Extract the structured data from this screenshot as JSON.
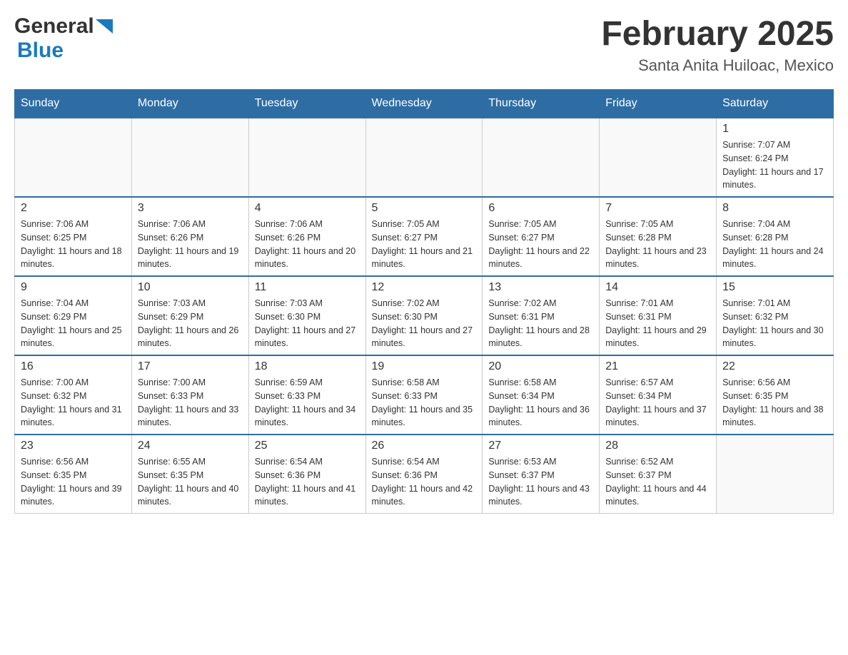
{
  "header": {
    "logo_general": "General",
    "logo_blue": "Blue",
    "month_title": "February 2025",
    "location": "Santa Anita Huiloac, Mexico"
  },
  "weekdays": [
    "Sunday",
    "Monday",
    "Tuesday",
    "Wednesday",
    "Thursday",
    "Friday",
    "Saturday"
  ],
  "weeks": [
    {
      "days": [
        {
          "number": "",
          "info": "",
          "empty": true
        },
        {
          "number": "",
          "info": "",
          "empty": true
        },
        {
          "number": "",
          "info": "",
          "empty": true
        },
        {
          "number": "",
          "info": "",
          "empty": true
        },
        {
          "number": "",
          "info": "",
          "empty": true
        },
        {
          "number": "",
          "info": "",
          "empty": true
        },
        {
          "number": "1",
          "info": "Sunrise: 7:07 AM\nSunset: 6:24 PM\nDaylight: 11 hours and 17 minutes.",
          "empty": false
        }
      ]
    },
    {
      "days": [
        {
          "number": "2",
          "info": "Sunrise: 7:06 AM\nSunset: 6:25 PM\nDaylight: 11 hours and 18 minutes.",
          "empty": false
        },
        {
          "number": "3",
          "info": "Sunrise: 7:06 AM\nSunset: 6:26 PM\nDaylight: 11 hours and 19 minutes.",
          "empty": false
        },
        {
          "number": "4",
          "info": "Sunrise: 7:06 AM\nSunset: 6:26 PM\nDaylight: 11 hours and 20 minutes.",
          "empty": false
        },
        {
          "number": "5",
          "info": "Sunrise: 7:05 AM\nSunset: 6:27 PM\nDaylight: 11 hours and 21 minutes.",
          "empty": false
        },
        {
          "number": "6",
          "info": "Sunrise: 7:05 AM\nSunset: 6:27 PM\nDaylight: 11 hours and 22 minutes.",
          "empty": false
        },
        {
          "number": "7",
          "info": "Sunrise: 7:05 AM\nSunset: 6:28 PM\nDaylight: 11 hours and 23 minutes.",
          "empty": false
        },
        {
          "number": "8",
          "info": "Sunrise: 7:04 AM\nSunset: 6:28 PM\nDaylight: 11 hours and 24 minutes.",
          "empty": false
        }
      ]
    },
    {
      "days": [
        {
          "number": "9",
          "info": "Sunrise: 7:04 AM\nSunset: 6:29 PM\nDaylight: 11 hours and 25 minutes.",
          "empty": false
        },
        {
          "number": "10",
          "info": "Sunrise: 7:03 AM\nSunset: 6:29 PM\nDaylight: 11 hours and 26 minutes.",
          "empty": false
        },
        {
          "number": "11",
          "info": "Sunrise: 7:03 AM\nSunset: 6:30 PM\nDaylight: 11 hours and 27 minutes.",
          "empty": false
        },
        {
          "number": "12",
          "info": "Sunrise: 7:02 AM\nSunset: 6:30 PM\nDaylight: 11 hours and 27 minutes.",
          "empty": false
        },
        {
          "number": "13",
          "info": "Sunrise: 7:02 AM\nSunset: 6:31 PM\nDaylight: 11 hours and 28 minutes.",
          "empty": false
        },
        {
          "number": "14",
          "info": "Sunrise: 7:01 AM\nSunset: 6:31 PM\nDaylight: 11 hours and 29 minutes.",
          "empty": false
        },
        {
          "number": "15",
          "info": "Sunrise: 7:01 AM\nSunset: 6:32 PM\nDaylight: 11 hours and 30 minutes.",
          "empty": false
        }
      ]
    },
    {
      "days": [
        {
          "number": "16",
          "info": "Sunrise: 7:00 AM\nSunset: 6:32 PM\nDaylight: 11 hours and 31 minutes.",
          "empty": false
        },
        {
          "number": "17",
          "info": "Sunrise: 7:00 AM\nSunset: 6:33 PM\nDaylight: 11 hours and 33 minutes.",
          "empty": false
        },
        {
          "number": "18",
          "info": "Sunrise: 6:59 AM\nSunset: 6:33 PM\nDaylight: 11 hours and 34 minutes.",
          "empty": false
        },
        {
          "number": "19",
          "info": "Sunrise: 6:58 AM\nSunset: 6:33 PM\nDaylight: 11 hours and 35 minutes.",
          "empty": false
        },
        {
          "number": "20",
          "info": "Sunrise: 6:58 AM\nSunset: 6:34 PM\nDaylight: 11 hours and 36 minutes.",
          "empty": false
        },
        {
          "number": "21",
          "info": "Sunrise: 6:57 AM\nSunset: 6:34 PM\nDaylight: 11 hours and 37 minutes.",
          "empty": false
        },
        {
          "number": "22",
          "info": "Sunrise: 6:56 AM\nSunset: 6:35 PM\nDaylight: 11 hours and 38 minutes.",
          "empty": false
        }
      ]
    },
    {
      "days": [
        {
          "number": "23",
          "info": "Sunrise: 6:56 AM\nSunset: 6:35 PM\nDaylight: 11 hours and 39 minutes.",
          "empty": false
        },
        {
          "number": "24",
          "info": "Sunrise: 6:55 AM\nSunset: 6:35 PM\nDaylight: 11 hours and 40 minutes.",
          "empty": false
        },
        {
          "number": "25",
          "info": "Sunrise: 6:54 AM\nSunset: 6:36 PM\nDaylight: 11 hours and 41 minutes.",
          "empty": false
        },
        {
          "number": "26",
          "info": "Sunrise: 6:54 AM\nSunset: 6:36 PM\nDaylight: 11 hours and 42 minutes.",
          "empty": false
        },
        {
          "number": "27",
          "info": "Sunrise: 6:53 AM\nSunset: 6:37 PM\nDaylight: 11 hours and 43 minutes.",
          "empty": false
        },
        {
          "number": "28",
          "info": "Sunrise: 6:52 AM\nSunset: 6:37 PM\nDaylight: 11 hours and 44 minutes.",
          "empty": false
        },
        {
          "number": "",
          "info": "",
          "empty": true
        }
      ]
    }
  ]
}
